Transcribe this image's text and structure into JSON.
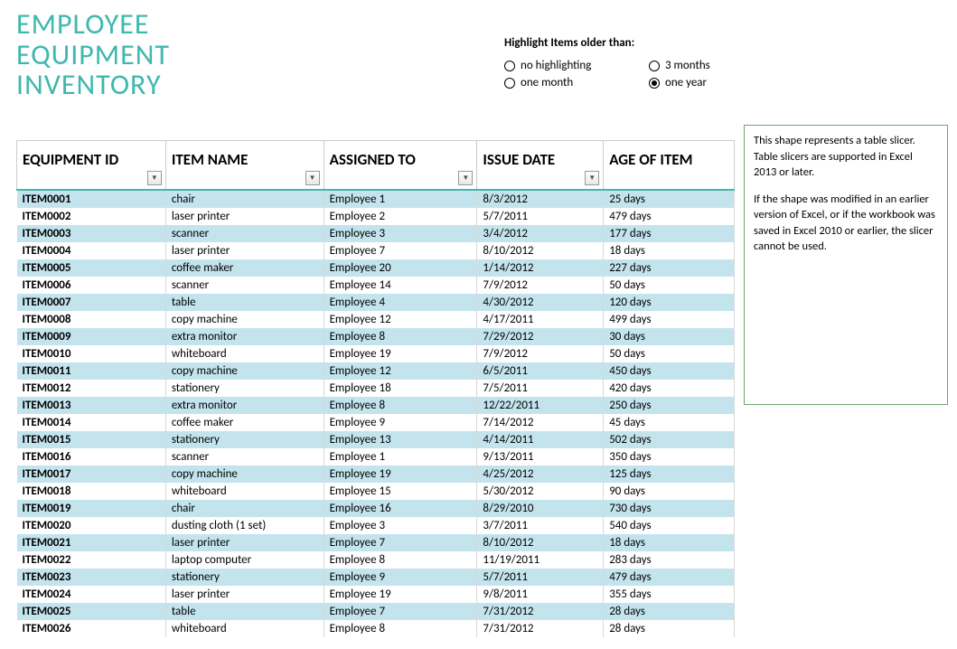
{
  "title_line1": "EMPLOYEE",
  "title_line2": "EQUIPMENT",
  "title_line3": "INVENTORY",
  "highlight": {
    "label": "Highlight Items older than:",
    "options": {
      "none": "no highlighting",
      "one_month": "one month",
      "three_months": "3 months",
      "one_year": "one year"
    },
    "selected": "one_year"
  },
  "columns": {
    "id": "EQUIPMENT ID",
    "name": "ITEM NAME",
    "assigned": "ASSIGNED TO",
    "date": "ISSUE DATE",
    "age": "AGE OF ITEM"
  },
  "rows": [
    {
      "id": "ITEM0001",
      "name": "chair",
      "assigned": "Employee 1",
      "date": "8/3/2012",
      "age": "25 days"
    },
    {
      "id": "ITEM0002",
      "name": "laser printer",
      "assigned": "Employee 2",
      "date": "5/7/2011",
      "age": "479 days"
    },
    {
      "id": "ITEM0003",
      "name": "scanner",
      "assigned": "Employee 3",
      "date": "3/4/2012",
      "age": "177 days"
    },
    {
      "id": "ITEM0004",
      "name": "laser printer",
      "assigned": "Employee 7",
      "date": "8/10/2012",
      "age": "18 days"
    },
    {
      "id": "ITEM0005",
      "name": "coffee maker",
      "assigned": "Employee 20",
      "date": "1/14/2012",
      "age": "227 days"
    },
    {
      "id": "ITEM0006",
      "name": "scanner",
      "assigned": "Employee 14",
      "date": "7/9/2012",
      "age": "50 days"
    },
    {
      "id": "ITEM0007",
      "name": "table",
      "assigned": "Employee 4",
      "date": "4/30/2012",
      "age": "120 days"
    },
    {
      "id": "ITEM0008",
      "name": "copy machine",
      "assigned": "Employee 12",
      "date": "4/17/2011",
      "age": "499 days"
    },
    {
      "id": "ITEM0009",
      "name": "extra monitor",
      "assigned": "Employee 8",
      "date": "7/29/2012",
      "age": "30 days"
    },
    {
      "id": "ITEM0010",
      "name": "whiteboard",
      "assigned": "Employee 19",
      "date": "7/9/2012",
      "age": "50 days"
    },
    {
      "id": "ITEM0011",
      "name": "copy machine",
      "assigned": "Employee 12",
      "date": "6/5/2011",
      "age": "450 days"
    },
    {
      "id": "ITEM0012",
      "name": "stationery",
      "assigned": "Employee 18",
      "date": "7/5/2011",
      "age": "420 days"
    },
    {
      "id": "ITEM0013",
      "name": "extra monitor",
      "assigned": "Employee 8",
      "date": "12/22/2011",
      "age": "250 days"
    },
    {
      "id": "ITEM0014",
      "name": "coffee maker",
      "assigned": "Employee 9",
      "date": "7/14/2012",
      "age": "45 days"
    },
    {
      "id": "ITEM0015",
      "name": "stationery",
      "assigned": "Employee 13",
      "date": "4/14/2011",
      "age": "502 days"
    },
    {
      "id": "ITEM0016",
      "name": "scanner",
      "assigned": "Employee 1",
      "date": "9/13/2011",
      "age": "350 days"
    },
    {
      "id": "ITEM0017",
      "name": "copy machine",
      "assigned": "Employee 19",
      "date": "4/25/2012",
      "age": "125 days"
    },
    {
      "id": "ITEM0018",
      "name": "whiteboard",
      "assigned": "Employee 15",
      "date": "5/30/2012",
      "age": "90 days"
    },
    {
      "id": "ITEM0019",
      "name": "chair",
      "assigned": "Employee 16",
      "date": "8/29/2010",
      "age": "730 days"
    },
    {
      "id": "ITEM0020",
      "name": "dusting cloth (1 set)",
      "assigned": "Employee 3",
      "date": "3/7/2011",
      "age": "540 days"
    },
    {
      "id": "ITEM0021",
      "name": "laser printer",
      "assigned": "Employee 7",
      "date": "8/10/2012",
      "age": "18 days"
    },
    {
      "id": "ITEM0022",
      "name": "laptop computer",
      "assigned": "Employee 8",
      "date": "11/19/2011",
      "age": "283 days"
    },
    {
      "id": "ITEM0023",
      "name": "stationery",
      "assigned": "Employee 9",
      "date": "5/7/2011",
      "age": "479 days"
    },
    {
      "id": "ITEM0024",
      "name": "laser printer",
      "assigned": "Employee 19",
      "date": "9/8/2011",
      "age": "355 days"
    },
    {
      "id": "ITEM0025",
      "name": "table",
      "assigned": "Employee 7",
      "date": "7/31/2012",
      "age": "28 days"
    },
    {
      "id": "ITEM0026",
      "name": "whiteboard",
      "assigned": "Employee 8",
      "date": "7/31/2012",
      "age": "28 days"
    }
  ],
  "slicer": {
    "p1": "This shape represents a table slicer. Table slicers are supported in Excel 2013 or later.",
    "p2": "If the shape was modified in an earlier version of Excel, or if the workbook was saved in Excel 2010 or earlier, the slicer cannot be used."
  }
}
